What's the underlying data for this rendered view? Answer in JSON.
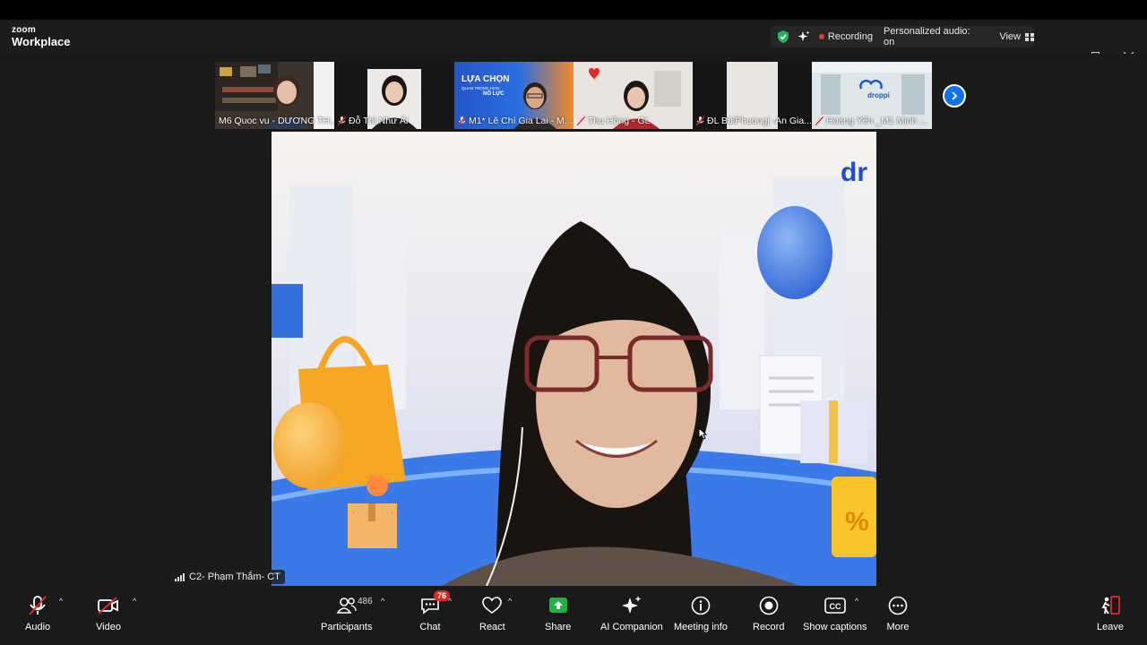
{
  "app": {
    "brand_small": "zoom",
    "brand_big": "Workplace"
  },
  "status": {
    "recording": "Recording",
    "audio": "Personalized audio: on",
    "view": "View"
  },
  "thumbnails": [
    {
      "name": "M6 Quoc vu - DƯƠNG TH..."
    },
    {
      "name": "Đỗ Thị Như Ái"
    },
    {
      "name": "M1* Lê Chí Gia Lai - M...",
      "banner": "LỰA CHỌN",
      "banner_sub": "QUAN TRỌNG HƠN",
      "banner_sub2": "NỖ LỰC"
    },
    {
      "name": "Thu Hồng - GL"
    },
    {
      "name": "ĐL BùiPhuongj -An Gia..."
    },
    {
      "name": "Hoàng Yến _M1 Minh ...",
      "logo": "droppi"
    }
  ],
  "main": {
    "speaker": "C2- Phạm Thắm- CT",
    "bg_logo": "dr"
  },
  "toolbar": {
    "audio": "Audio",
    "video": "Video",
    "participants": "Participants",
    "participants_count": "486",
    "chat": "Chat",
    "chat_badge": "76",
    "react": "React",
    "share": "Share",
    "ai": "AI Companion",
    "info": "Meeting info",
    "record": "Record",
    "captions": "Show captions",
    "captions_icon": "CC",
    "more": "More",
    "leave": "Leave"
  },
  "colors": {
    "accent": "#0e72ed",
    "share": "#1fb141",
    "danger": "#e02828"
  },
  "icons": [
    "shield-check-icon",
    "sparkle-icon",
    "minimize-icon",
    "restore-icon",
    "close-icon",
    "mic-muted-icon",
    "video-off-icon",
    "participants-icon",
    "chat-icon",
    "heart-icon",
    "share-icon",
    "ai-sparkle-icon",
    "info-icon",
    "record-icon",
    "cc-icon",
    "more-icon",
    "leave-icon"
  ]
}
